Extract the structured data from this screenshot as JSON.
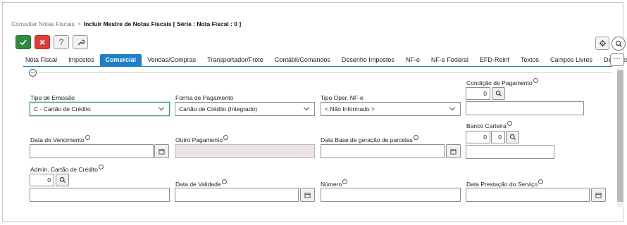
{
  "breadcrumb": {
    "parent": "Consultar Notas Fiscais",
    "separator": ">",
    "current": "Incluir Mestre de Notas Fiscais [ Série : Nota Fiscal : 0 ]"
  },
  "toolbar": {
    "help_label": "?"
  },
  "tabs": [
    {
      "label": "Nota Fiscal"
    },
    {
      "label": "Impostos"
    },
    {
      "label": "Comercial"
    },
    {
      "label": "Vendas/Compras"
    },
    {
      "label": "Transportador/Frete"
    },
    {
      "label": "Contábil/Comandos"
    },
    {
      "label": "Desenho Impostos"
    },
    {
      "label": "NF-e"
    },
    {
      "label": "NF-e Federal"
    },
    {
      "label": "EFD-Reinf"
    },
    {
      "label": "Textos"
    },
    {
      "label": "Campos Livres"
    },
    {
      "label": "Detalhes"
    }
  ],
  "active_tab": "Comercial",
  "tab_more": "···",
  "colors": {
    "accent": "#1e7fc9",
    "confirm": "#2e8b3e",
    "cancel": "#e03a3a",
    "focus": "#3aa675"
  },
  "form": {
    "tipo_emissao": {
      "label": "Tipo de Emissão",
      "value": "C - Cartão de Crédito"
    },
    "forma_pagamento": {
      "label": "Forma de Pagamento",
      "value": "Cartão de Crédito (Integrado)"
    },
    "tipo_oper_nfe": {
      "label": "Tipo Oper. NF-e",
      "value": "< Não Informado >"
    },
    "condicao_pagamento": {
      "label": "Condição de Pagamento",
      "value": "0"
    },
    "data_vencimento": {
      "label": "Data do Vencimento",
      "value": ""
    },
    "outro_pagamento": {
      "label": "Outro Pagamento",
      "value": ""
    },
    "data_base_parcelas": {
      "label": "Data Base de geração de parcelas",
      "value": ""
    },
    "banco_carteira": {
      "label": "Banco Carteira",
      "banco": "0",
      "carteira": "0"
    },
    "admin_cartao": {
      "label": "Admin. Cartão de Crédito",
      "value": "0"
    },
    "data_validade": {
      "label": "Data de Validade",
      "value": ""
    },
    "numero": {
      "label": "Número",
      "value": ""
    },
    "data_prestacao": {
      "label": "Data Prestação do Serviço",
      "value": ""
    }
  }
}
